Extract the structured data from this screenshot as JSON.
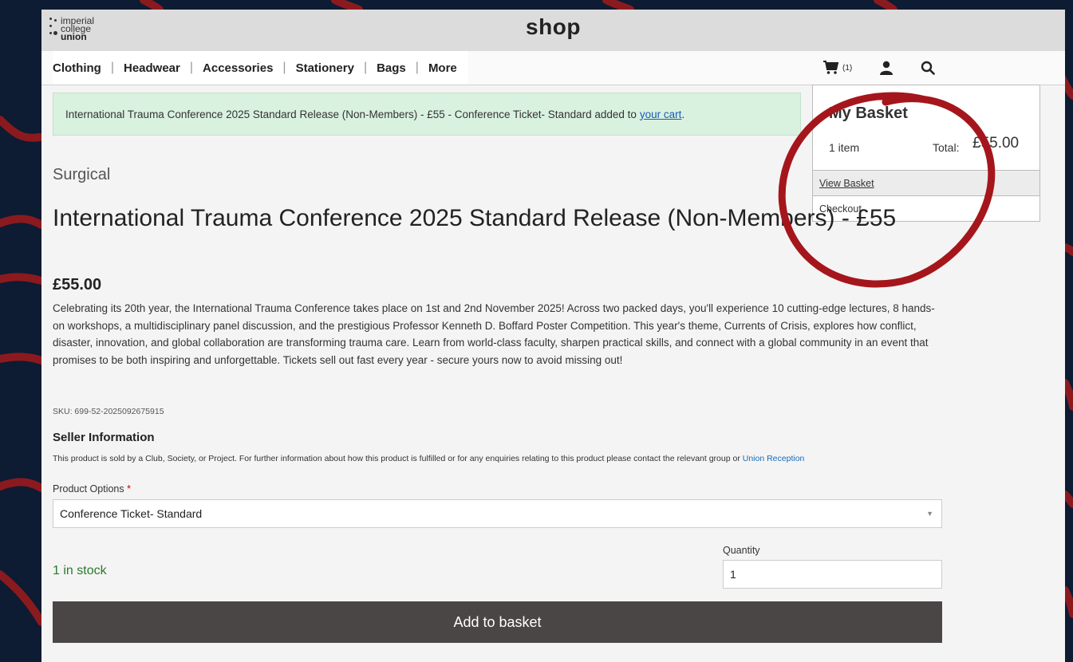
{
  "logo": {
    "line1": "imperial",
    "line2": "college",
    "line3": "union"
  },
  "header": {
    "title": "shop"
  },
  "nav": {
    "items": [
      "Clothing",
      "Headwear",
      "Accessories",
      "Stationery",
      "Bags",
      "More"
    ],
    "separator": "|"
  },
  "icons": {
    "cart": "cart-icon",
    "account": "user-icon",
    "search": "search-icon"
  },
  "cart": {
    "count_badge": "(1)"
  },
  "alert": {
    "message": "International Trauma Conference 2025 Standard Release (Non-Members) - £55 - Conference Ticket- Standard added to",
    "link": "your cart",
    "trailing": "."
  },
  "basket": {
    "title": "My Basket",
    "item_count": "1 item",
    "total_label": "Total:",
    "total_value": "£55.00",
    "view_basket": "View Basket",
    "checkout": "Checkout"
  },
  "product": {
    "category": "Surgical",
    "title": "International Trauma Conference 2025 Standard Release (Non-Members) - £55",
    "price": "£55.00",
    "description": "Celebrating its 20th year, the International Trauma Conference takes place on 1st and 2nd November 2025! Across two packed days, you'll experience 10 cutting-edge lectures, 8 hands-on workshops, a multidisciplinary panel discussion, and the prestigious Professor Kenneth D. Boffard Poster Competition. This year's theme, Currents of Crisis, explores how conflict, disaster, innovation, and global collaboration are transforming trauma care. Learn from world-class faculty, sharpen practical skills, and connect with a global community in an event that promises to be both inspiring and unforgettable. Tickets sell out fast every year - secure yours now to avoid missing out!",
    "sku": "SKU: 699-52-2025092675915"
  },
  "seller": {
    "heading": "Seller Information",
    "text": "This product is sold by a Club, Society, or Project. For further information about how this product is fulfilled or for any enquiries relating to this product please contact the relevant group or",
    "link": "Union Reception"
  },
  "options": {
    "label": "Product Options",
    "required_mark": "*",
    "selected": "Conference Ticket- Standard",
    "caret": "▼"
  },
  "stock": {
    "text": "1 in stock"
  },
  "quantity": {
    "label": "Quantity",
    "value": "1"
  },
  "add_button": {
    "label": "Add to basket"
  },
  "colors": {
    "background": "#0d1b33",
    "swirl": "#8b1a1f",
    "annotation": "#a5161c",
    "alert_bg": "#d9f1df",
    "button": "#4a4646",
    "stock": "#2a7a2a"
  }
}
